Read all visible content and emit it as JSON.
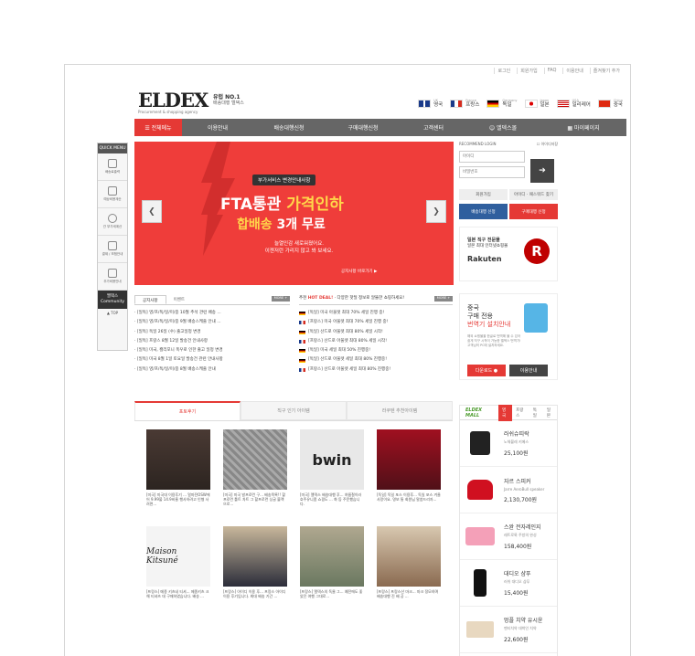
{
  "toplinks": [
    "로그인",
    "회원가입",
    "FAQ",
    "이용안내",
    "즐겨찾기 추가"
  ],
  "logo": {
    "name": "ELDEX",
    "sub": "Procurement & shopping agency",
    "tagline": "유럽 NO.1",
    "tagline2": "배송대행 엘덱스"
  },
  "countries": [
    {
      "en": "UK",
      "ko": "영국"
    },
    {
      "en": "France",
      "ko": "프랑스"
    },
    {
      "en": "Germany",
      "ko": "독일"
    },
    {
      "en": "Japan",
      "ko": "일본"
    },
    {
      "en": "USA",
      "ko": "일리레어"
    },
    {
      "en": "China",
      "ko": "중국"
    }
  ],
  "gnb": [
    "☰ 전체메뉴",
    "이용안내",
    "배송대행신청",
    "구매대행신청",
    "고객센터",
    "☺ 엘덱스몰",
    "▦ 마이페이지"
  ],
  "quick": {
    "header": "QUICK MENU",
    "items": [
      "배송료출력",
      "예상비용계산",
      "관 부가세계산",
      "결제 / 보험안내",
      "추가비용안내"
    ],
    "community": "엘덱스 Community",
    "top": "▲ TOP"
  },
  "banner": {
    "tag": "부가서비스 변경안내사항",
    "line1a": "FTA통관 ",
    "line1b": "가격인하",
    "line2a": "합배송 ",
    "line2b": "3개 무료",
    "desc1": "늘열인감 새로워졌어요.",
    "desc2": "이젠저런 가리지 않고 봐 보세요.",
    "more": "공지사항 바로가기 ▶"
  },
  "login": {
    "id_label": "RECOMMEND LOGIN",
    "save": "아이디저장",
    "id_placeholder": "아이디",
    "pw_placeholder": "비밀번호",
    "go": "➔"
  },
  "login_buttons": [
    "회원가입",
    "아이디 · 패스워드 찾기"
  ],
  "request_buttons": [
    "배송대행 신청",
    "구매대행 신청"
  ],
  "rakuten": {
    "t1": "일본 직구 전문몰",
    "t2": "일본 최대 인터넷쇼핑몰",
    "logo": "Rakuten",
    "circle": "R"
  },
  "notice": {
    "tabs": [
      "공지사항",
      "이벤트"
    ],
    "more": "MORE +",
    "items": [
      "· [일독] 영/프/독/일/미/중 10월 추석 관련 배송 ...",
      "· [일독] 영/프/독/일/미/중 9월 배송스케줄 안내 ...",
      "· [일독] 독일 26일 (수) 출고일정 변경",
      "· [일독] 프랑스 8월 12일 발송건 안내사항",
      "· [일독] 미국, 캘리포니 폭우로 인한 출고 일정 변경",
      "· [일독] 미국 8월 1일 토요일 발송건 관련 안내사항",
      "· [일독] 영/프/독/일/미/중 8월 배송스케줄 안내"
    ]
  },
  "hotdeal": {
    "prefix": "추천 ",
    "hot": "HOT DEAL!",
    "rest": " · 다양한 핫딜 정보로 알뜰한 쇼핑하세요!",
    "more": "MORE +",
    "items": [
      "[독일] 미국 아울렛 최대 70% 세일 진행 중!",
      "[프랑스] 미국 아울렛 최대 70% 세일 진행 중!",
      "[독일] 산드로 아울렛 최대 80% 세일 시작!",
      "[프랑스] 산드로 아울렛 최대 80% 세일 시작!",
      "[독일] 미국 세일 최대 50% 진행중!",
      "[독일] 산드로 아울렛 세일 최대 80% 진행중!",
      "[프랑스] 산드로 아울렛 세일 최대 80% 진행중!"
    ]
  },
  "app": {
    "a1": "중국",
    "a2": "구매 전용",
    "a3": "번역기 설치안내",
    "a4": "해외 쇼핑몰을 한글로 번역해 볼 수 있어 쉽게 직구 시작이 가능한 엘덱스 번역기! 고객님의 PC에 설치하세요.",
    "download": "다운로드 ●",
    "guide": "이용안내"
  },
  "photo": {
    "tabs": [
      "포토후기",
      "직구 인기 아이템",
      "라쿠텐 추천아이템"
    ],
    "cards": [
      "[미국] 미국대 이용후기 ... 얼마전OSW에어 9.99불 14.9비율 행사하려고 인형 사려면...",
      "[미국] 미국 발프로런 구... 배송목록!! 할프로런 톨트 차트 그 할프로런 싱글 블랙으로...",
      "[미국] 엘덱스 배송대행 후... 여름철이라 호주유니폼 쇼핑도 ... 화 등 주문했습니다.",
      "[독일] 독일 포스 이용후... 독일 포스 겨울 사랑이요. 명보 통 회원님 말씀드리자...",
      "[프랑스] 메종 키츠네 티셔... 메종키츠 크해 티셔츠 데 구매하였습니다. 배송 ...",
      "[프랑스] 아이디 이용 후... 프랑스 아이디 이용 후기입니다. 최대 배송 기간 ...",
      "[프랑스] 엘덱스의 독물 그... 예전에도 좋았던 여행 그대로...",
      "[프랑스] 프랑스산 마크... 마크 정모하며 배송대행 진 배 공 ..."
    ]
  },
  "eldexmall": {
    "logo": "ELDEX MALL",
    "tabs": [
      "영국",
      "프랑스",
      "독일",
      "일본"
    ],
    "items": [
      {
        "n": "러쉬슈띠락",
        "s": "노체블레 키메스",
        "p": "25,100원"
      },
      {
        "n": "자르 스피커",
        "s": "Jarre AeroBull speaker",
        "p": "2,130,700원"
      },
      {
        "n": "스완 전자레인지",
        "s": "레트로룩 주방의 완성",
        "p": "158,400원"
      },
      {
        "n": "대디오 샴푸",
        "s": "러쉬 대디오 샴푸",
        "p": "15,400원"
      },
      {
        "n": "멍플 치약 유시윤",
        "s": "멘티치약 대박인 치약",
        "p": "22,600원"
      }
    ]
  },
  "colors": {
    "accent": "#e53935",
    "nav": "#666666"
  }
}
